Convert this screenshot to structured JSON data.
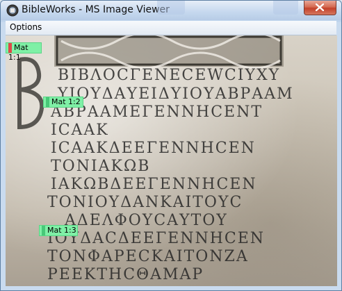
{
  "window": {
    "title": "BibleWorks - MS Image Viewer"
  },
  "menu": {
    "items": [
      "Options"
    ]
  },
  "manuscript": {
    "lines": [
      "BIBΛOCΓENECEWCIYXY",
      "YIOYΔΑΥΕΙΔΥIOYΑΒΡΑΑΜ",
      "ΑΒΡΑΑΜΕΓΕΝΝΗCΕΝΤ",
      "ICΑΑΚ",
      "ICΑΑΚΔΕΕΓΕΝΝΗCΕΝ",
      "ΤΟΝΙΑΚΩΒ",
      "ΙΑΚΩΒΔΕΕΓΕΝΝΗCΕΝ",
      "ΤΟΝΙΟΥΔΑΝΚΑΙΤΟΥC",
      "ΑΔΕΛΦΟΥCΑΥΤΟΥ",
      "ΙΟΥΔΑCΔΕΕΓΕΝΝΗCΕΝ",
      "ΤΟΝΦΑΡΕCΚΑΙΤΟΝΖΑ",
      "ΡΕΕΚΤΗCΘΑΜΑΡ"
    ]
  },
  "verse_tags": [
    {
      "label": "Mat 1:1",
      "marker_color": "#e04848"
    },
    {
      "label": "Mat 1:2",
      "marker_color": "#48c878"
    },
    {
      "label": "Mat 1:3",
      "marker_color": "#48c878"
    }
  ]
}
